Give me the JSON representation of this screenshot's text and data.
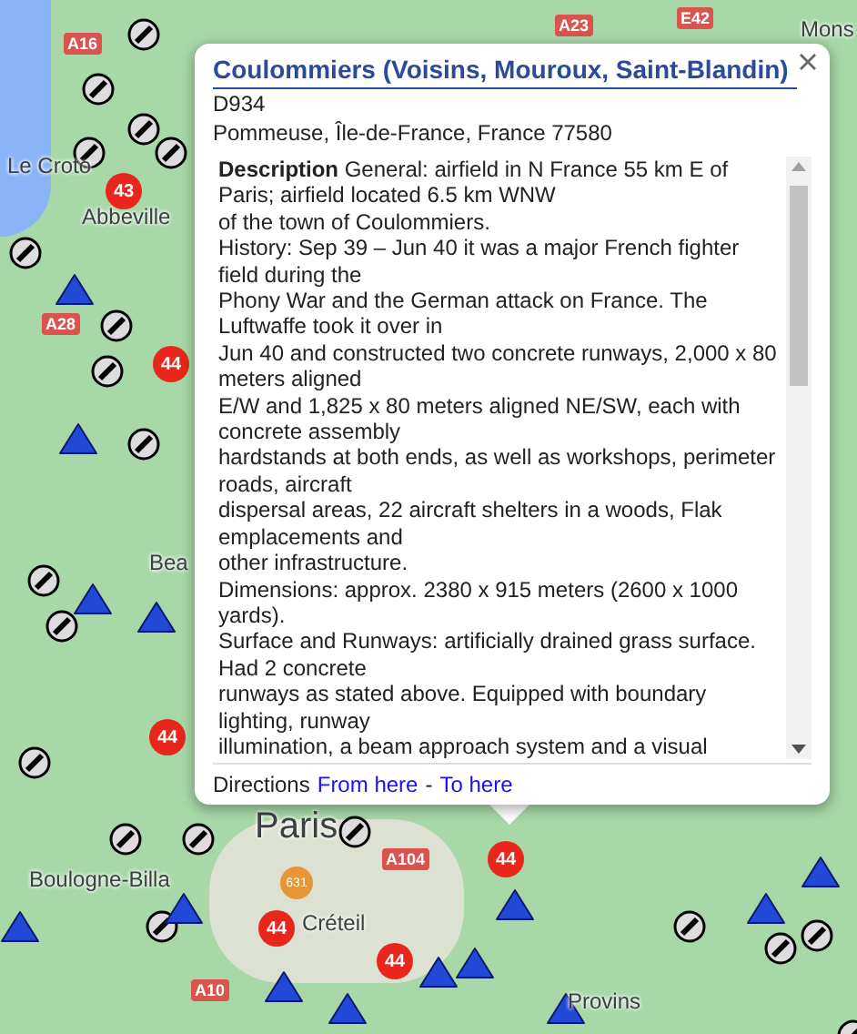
{
  "map": {
    "places": [
      "Abbeville",
      "Le Croto",
      "Bea",
      "Mons",
      "Paris",
      "Boulogne-Billa",
      "Créteil",
      "Provins"
    ],
    "roads": [
      "A23",
      "E42",
      "A16",
      "A28",
      "A10",
      "A104"
    ],
    "badges": [
      "43",
      "44",
      "44",
      "44",
      "44",
      "44"
    ],
    "pin": "631"
  },
  "popup": {
    "title": "Coulommiers (Voisins, Mouroux, Saint-Blandin)",
    "address": [
      "D934",
      "Pommeuse, Île-de-France, France 77580"
    ],
    "description": [
      "**Description** General: airfield in N France 55 km E of Paris; airfield located 6.5 km WNW",
      "of the town of Coulommiers.",
      "History: Sep 39 – Jun 40 it was a major French fighter field during the",
      "Phony War and the German attack on France. The Luftwaffe took it over in",
      "Jun 40 and constructed two concrete runways, 2,000 x 80 meters aligned",
      "E/W and 1,825 x 80 meters aligned NE/SW, each with concrete assembly",
      "hardstands at both ends, as well as workshops, perimeter roads, aircraft",
      "dispersal areas, 22 aircraft shelters in a woods, Flak emplacements and",
      "other infrastructure.",
      "Dimensions: approx. 2380 x 915 meters (2600 x 1000 yards).",
      "Surface and Runways: artificially drained grass surface. Had 2 concrete",
      "runways as stated above. Equipped with boundary lighting, runway",
      "illumination, a beam approach system and a visual"
    ],
    "directions": {
      "label": "Directions",
      "links": [
        "From here",
        "To here"
      ],
      "separator": "-"
    }
  }
}
